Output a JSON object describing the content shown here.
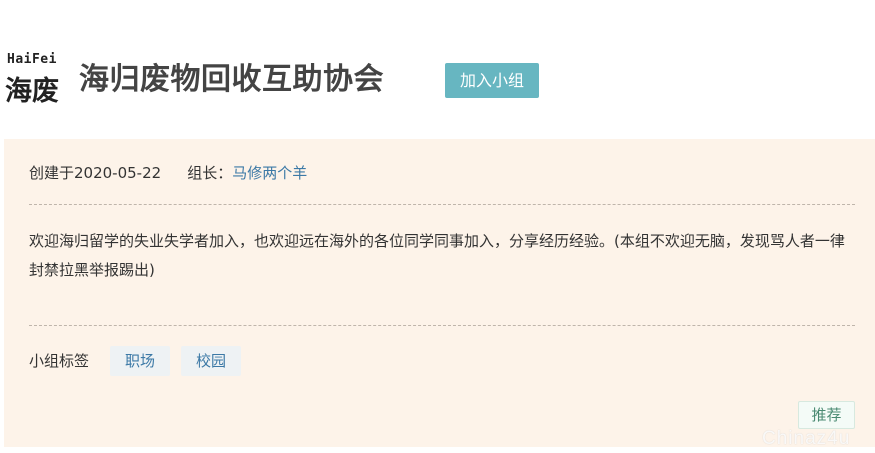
{
  "header": {
    "logo_latin": "HaiFei",
    "logo_cn": "海废",
    "group_title": "海归废物回收互助协会",
    "join_button_label": "加入小组",
    "join_button_color": "#67b6c1"
  },
  "info": {
    "created_label": "创建于2020-05-22",
    "leader_label": "组长：",
    "leader_name": "马修两个羊"
  },
  "description": "欢迎海归留学的失业失学者加入，也欢迎远在海外的各位同学同事加入，分享经历经验。(本组不欢迎无脑，发现骂人者一律封禁拉黑举报踢出)",
  "tags": {
    "label": "小组标签",
    "items": [
      "职场",
      "校园"
    ]
  },
  "recommend_label": "推荐",
  "watermark": "Chinaz4u",
  "colors": {
    "panel_bg": "#fdf3e9",
    "link": "#3c79a6"
  }
}
